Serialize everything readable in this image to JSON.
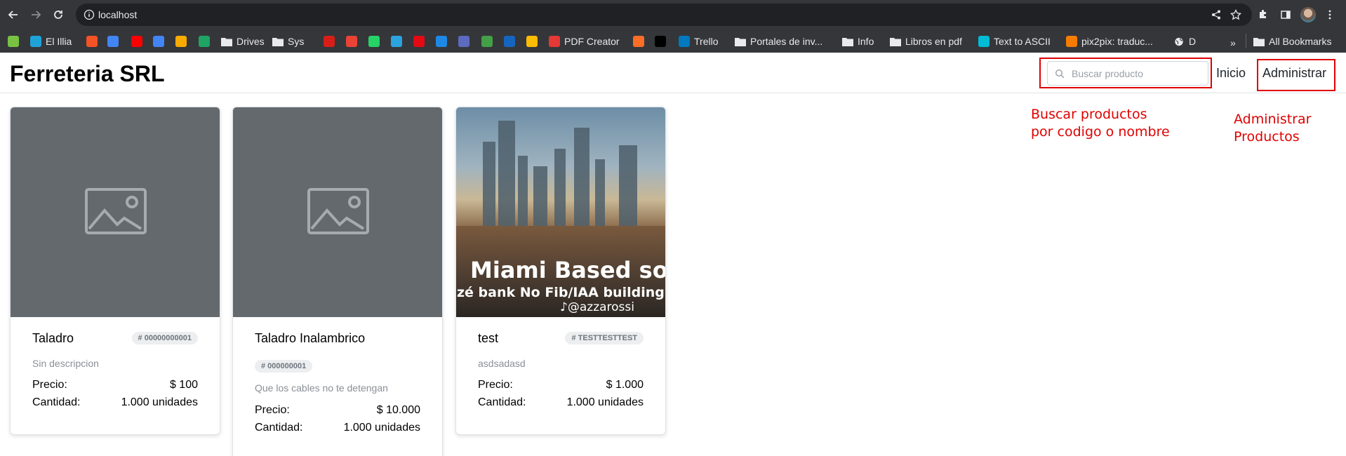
{
  "browser": {
    "url": "localhost",
    "bookmarks": [
      {
        "label": "",
        "icon": "reflex-icon",
        "color": "#79c142"
      },
      {
        "label": "El Illia",
        "icon": "el-illia-icon",
        "color": "#1fa2d8"
      },
      {
        "label": "",
        "icon": "microsoft-icon",
        "color": "#f35325"
      },
      {
        "label": "",
        "icon": "calendar-icon",
        "color": "#4285f4"
      },
      {
        "label": "",
        "icon": "youtube-icon",
        "color": "#ff0000"
      },
      {
        "label": "",
        "icon": "translate-icon",
        "color": "#4285f4"
      },
      {
        "label": "",
        "icon": "classroom-icon",
        "color": "#f9ab00"
      },
      {
        "label": "",
        "icon": "drive-icon",
        "color": "#1fa463"
      },
      {
        "label": "Drives",
        "icon": "folder-icon"
      },
      {
        "label": "Sys",
        "icon": "folder-icon"
      },
      {
        "label": "",
        "icon": "star-icon",
        "color": "#d91e18"
      },
      {
        "label": "",
        "icon": "gmail-icon",
        "color": "#ea4335"
      },
      {
        "label": "",
        "icon": "whatsapp-icon",
        "color": "#25d366"
      },
      {
        "label": "",
        "icon": "telegram-icon",
        "color": "#2aa3df"
      },
      {
        "label": "",
        "icon": "netflix-icon",
        "color": "#e50914"
      },
      {
        "label": "",
        "icon": "play-icon",
        "color": "#1e88e5"
      },
      {
        "label": "",
        "icon": "classroom-board-icon",
        "color": "#5c6bc0"
      },
      {
        "label": "",
        "icon": "doc-icon",
        "color": "#43a047"
      },
      {
        "label": "",
        "icon": "magnet-icon",
        "color": "#1565c0"
      },
      {
        "label": "",
        "icon": "photos-icon",
        "color": "#fbbc04"
      },
      {
        "label": "PDF Creator",
        "icon": "pdf-creator-icon",
        "color": "#e53935"
      },
      {
        "label": "",
        "icon": "gitlab-icon",
        "color": "#fc6d26"
      },
      {
        "label": "",
        "icon": "x-icon",
        "color": "#000000"
      },
      {
        "label": "Trello",
        "icon": "trello-icon",
        "color": "#0079bf"
      },
      {
        "label": "Portales de inv...",
        "icon": "folder-icon"
      },
      {
        "label": "Info",
        "icon": "folder-icon"
      },
      {
        "label": "Libros en pdf",
        "icon": "folder-icon"
      },
      {
        "label": "Text to ASCII",
        "icon": "text-ascii-icon",
        "color": "#00bcd4"
      },
      {
        "label": "pix2pix: traduc...",
        "icon": "pix2pix-icon",
        "color": "#f57c00"
      },
      {
        "label": "D",
        "icon": "globe-icon"
      }
    ],
    "all_bookmarks": "All Bookmarks",
    "more_chevron": "»"
  },
  "app": {
    "brand": "Ferreteria SRL",
    "search_placeholder": "Buscar producto",
    "nav_inicio": "Inicio",
    "nav_admin": "Administrar"
  },
  "annotations": {
    "search_line1": "Buscar productos",
    "search_line2": "por codigo o nombre",
    "admin_line1": "Administrar",
    "admin_line2": "Productos",
    "color": "#e00000"
  },
  "products": [
    {
      "name": "Taladro",
      "code": "# 00000000001",
      "description": "Sin descripcion",
      "price_label": "Precio:",
      "price": "$ 100",
      "qty_label": "Cantidad:",
      "qty": "1.000 unidades",
      "image": "placeholder"
    },
    {
      "name": "Taladro Inalambrico",
      "code": "# 000000001",
      "description": "Que los cables no te detengan",
      "price_label": "Precio:",
      "price": "$ 10.000",
      "qty_label": "Cantidad:",
      "qty": "1.000 unidades",
      "image": "placeholder"
    },
    {
      "name": "test",
      "code": "# TESTTESTTEST",
      "description": "asdsadasd",
      "price_label": "Precio:",
      "price": "$ 1.000",
      "qty_label": "Cantidad:",
      "qty": "1.000 unidades",
      "image": "photo",
      "image_text1": "Miami Based soo.",
      "image_text2": "zé bank No Fib/IAA  buildings",
      "image_text3": "♪@azzarossi"
    }
  ]
}
